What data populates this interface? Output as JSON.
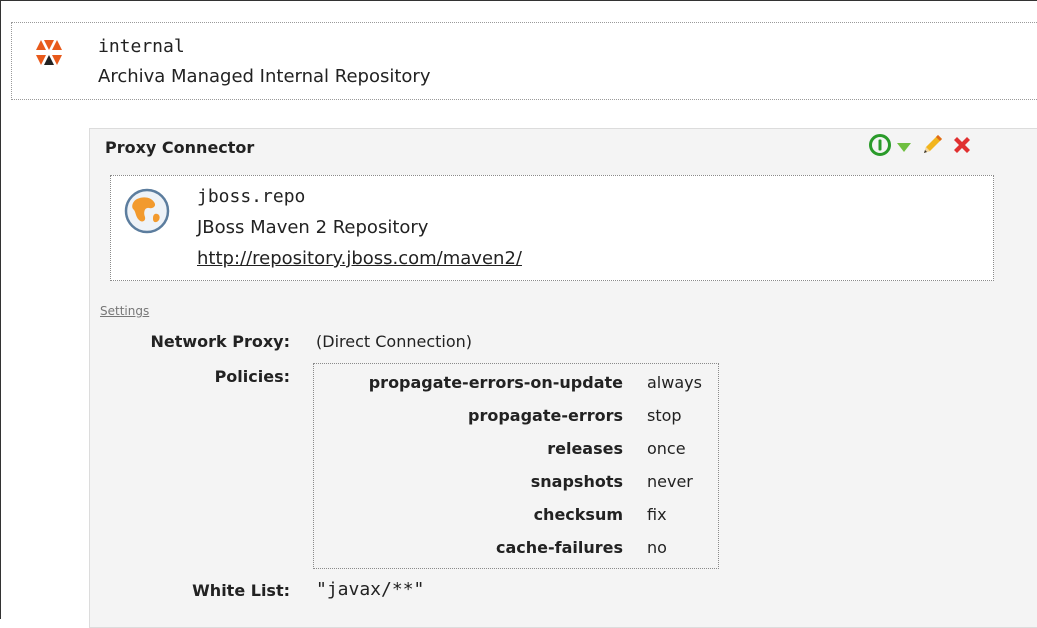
{
  "repository": {
    "id": "internal",
    "name": "Archiva Managed Internal Repository",
    "icon": "archiva-logo-icon"
  },
  "connector": {
    "title": "Proxy Connector",
    "actions": [
      {
        "name": "enable-toggle-icon",
        "color": "#2a9b2a"
      },
      {
        "name": "dropdown-triangle-icon",
        "color": "#6fbf40"
      },
      {
        "name": "pencil-edit-icon",
        "color": "#e8a000"
      },
      {
        "name": "delete-x-icon",
        "color": "#e03030"
      }
    ],
    "remote": {
      "id": "jboss.repo",
      "name": "JBoss Maven 2 Repository",
      "url": "http://repository.jboss.com/maven2/",
      "icon": "globe-icon"
    },
    "settings_label": "Settings",
    "network_proxy_label": "Network Proxy:",
    "network_proxy_value": "(Direct Connection)",
    "policies_label": "Policies:",
    "policies": [
      {
        "name": "propagate-errors-on-update",
        "value": "always"
      },
      {
        "name": "propagate-errors",
        "value": "stop"
      },
      {
        "name": "releases",
        "value": "once"
      },
      {
        "name": "snapshots",
        "value": "never"
      },
      {
        "name": "checksum",
        "value": "fix"
      },
      {
        "name": "cache-failures",
        "value": "no"
      }
    ],
    "white_list_label": "White List:",
    "white_list_value": "\"javax/**\""
  }
}
